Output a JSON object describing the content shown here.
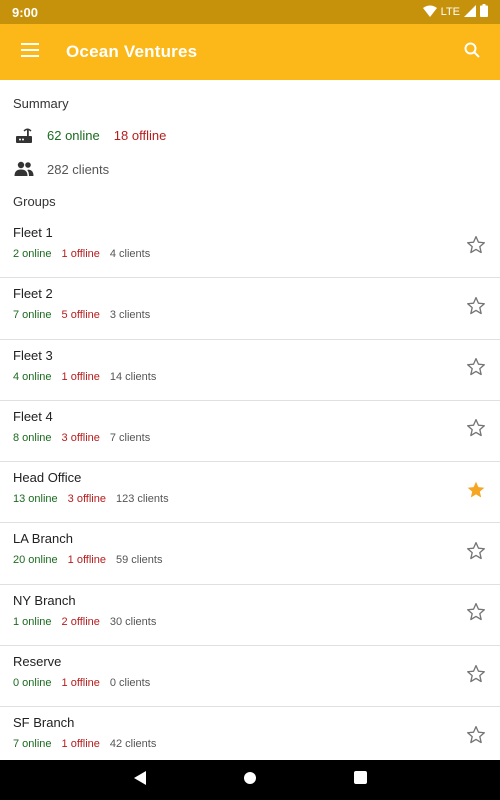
{
  "status_bar": {
    "time": "9:00",
    "network": "LTE"
  },
  "app_bar": {
    "title": "Ocean Ventures",
    "menu_icon": "menu-icon",
    "search_icon": "search-icon"
  },
  "summary": {
    "label": "Summary",
    "online": "62 online",
    "offline": "18 offline",
    "clients": "282 clients"
  },
  "groups_label": "Groups",
  "groups": [
    {
      "name": "Fleet 1",
      "online": "2 online",
      "offline": "1 offline",
      "clients": "4 clients",
      "starred": false
    },
    {
      "name": "Fleet 2",
      "online": "7 online",
      "offline": "5 offline",
      "clients": "3 clients",
      "starred": false
    },
    {
      "name": "Fleet 3",
      "online": "4 online",
      "offline": "1 offline",
      "clients": "14 clients",
      "starred": false
    },
    {
      "name": "Fleet 4",
      "online": "8 online",
      "offline": "3 offline",
      "clients": "7 clients",
      "starred": false
    },
    {
      "name": "Head Office",
      "online": "13 online",
      "offline": "3 offline",
      "clients": "123 clients",
      "starred": true
    },
    {
      "name": "LA Branch",
      "online": "20 online",
      "offline": "1 offline",
      "clients": "59 clients",
      "starred": false
    },
    {
      "name": "NY Branch",
      "online": "1 online",
      "offline": "2 offline",
      "clients": "30 clients",
      "starred": false
    },
    {
      "name": "Reserve",
      "online": "0 online",
      "offline": "1 offline",
      "clients": "0 clients",
      "starred": false
    },
    {
      "name": "SF Branch",
      "online": "7 online",
      "offline": "1 offline",
      "clients": "42 clients",
      "starred": false
    }
  ],
  "colors": {
    "app_bar": "#fbb818",
    "status_bar": "#c7920b",
    "online": "#1b6b1f",
    "offline": "#b71c1c",
    "star_active": "#f5a623"
  }
}
